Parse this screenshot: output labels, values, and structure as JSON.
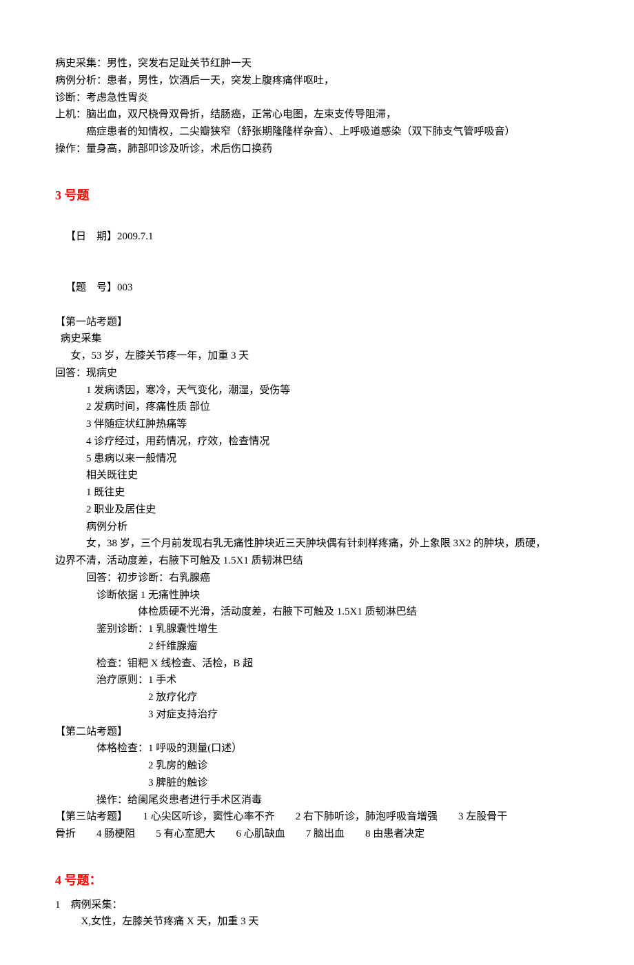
{
  "intro": {
    "l1": "病史采集：男性，突发右足趾关节红肿一天",
    "l2": "病例分析：患者，男性，饮酒后一天，突发上腹疼痛伴呕吐，",
    "l3": "诊断：考虑急性胃炎",
    "l4": "上机：脑出血，双尺桡骨双骨折，结肠癌，正常心电图，左束支传导阻滞，",
    "l5": "癌症患者的知情权，二尖瓣狭窄（舒张期隆隆样杂音）、上呼吸道感染（双下肺支气管呼吸音）",
    "l6": "操作：量身高，肺部叩诊及听诊，术后伤口换药"
  },
  "q3": {
    "title": "3 号题",
    "date_label": "【日　期】",
    "date_value": "2009.7.1",
    "num_label": "【题　号】",
    "num_value": "003",
    "station1_label": "【第一站考题】",
    "bscj_label": "病史采集",
    "bscj_case": "女，53 岁，左膝关节疼一年，加重 3 天",
    "answer_label": "回答：现病史",
    "a1": "1 发病诱因，寒冷，天气变化，潮湿，受伤等",
    "a2": "2 发病时间，疼痛性质 部位",
    "a3": "3 伴随症状红肿热痛等",
    "a4": "4 诊疗经过，用药情况，疗效，检查情况",
    "a5": "5 患病以来一般情况",
    "past_label": "相关既往史",
    "a6": "1 既往史",
    "a7": "2 职业及居住史",
    "blfx_label": "病例分析",
    "blfx_case_a": "女，38 岁，三个月前发现右乳无痛性肿块近三天肿块偶有针刺样疼痛，外上象限 3X2 的肿块，质硬，",
    "blfx_case_b": "边界不清，活动度差，右腋下可触及 1.5X1 质韧淋巴结",
    "init_dx": "回答：初步诊断：右乳腺癌",
    "dx_basis_1": "诊断依据 1 无痛性肿块",
    "dx_basis_2": "体检质硬不光滑，活动度差，右腋下可触及 1.5X1 质韧淋巴结",
    "ddx_label": "鉴别诊断：1 乳腺囊性增生",
    "ddx_2": "2 纤维腺瘤",
    "exam_label": "检查：钼粑 X 线检查、活检，B 超",
    "tx_label": "治疗原则：1 手术",
    "tx_2": "2 放疗化疗",
    "tx_3": "3 对症支持治疗",
    "station2_label": "【第二站考题】",
    "pe_label": "体格检查：1 呼吸的测量(口述）",
    "pe_2": "2 乳房的触诊",
    "pe_3": "3 脾脏的触诊",
    "op_label": "操作：给阑尾炎患者进行手术区消毒",
    "station3_line1": "【第三站考题】　　1 心尖区听诊，窦性心率不齐　　2 右下肺听诊，肺泡呼吸音增强　　3 左股骨干",
    "station3_line2": "骨折　　4 肠梗阻　　5 有心室肥大　　6 心肌缺血　　7 脑出血　　8 由患者决定"
  },
  "q4": {
    "title": "4 号题：",
    "l1": "1　病例采集：",
    "l2": "X,女性，左膝关节疼痛 X 天，加重 3 天"
  }
}
